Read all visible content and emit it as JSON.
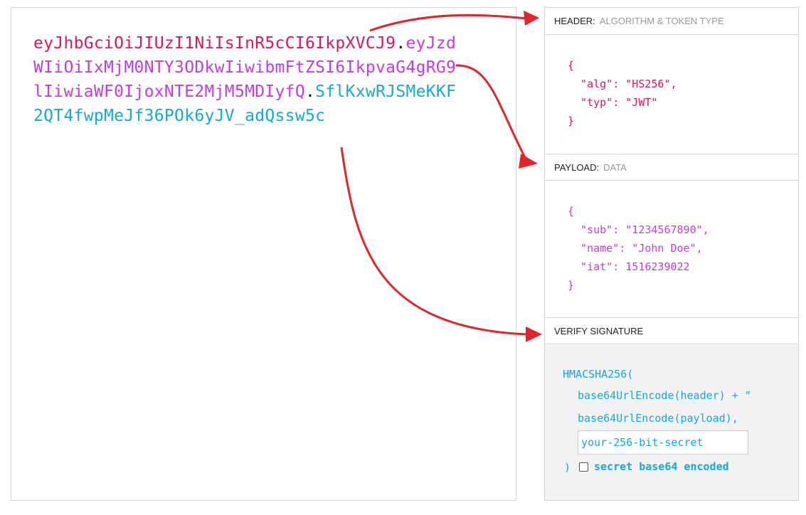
{
  "token": {
    "header_part": "eyJhbGciOiJIUzI1NiIsInR5cCI6IkpXVCJ9",
    "payload_part": "eyJzdWIiOiIxMjM0NTY3ODkwIiwibmFtZSI6IkpvaG4gRG9lIiwiaWF0IjoxNTE2MjM5MDIyfQ",
    "signature_part": "SflKxwRJSMeKKF2QT4fwpMeJf36POk6yJV_adQssw5c",
    "dot": "."
  },
  "header_section": {
    "title": "HEADER:",
    "subtitle": "ALGORITHM & TOKEN TYPE",
    "lines": [
      "{",
      "  \"alg\": \"HS256\",",
      "  \"typ\": \"JWT\"",
      "}"
    ]
  },
  "payload_section": {
    "title": "PAYLOAD:",
    "subtitle": "DATA",
    "lines": [
      "{",
      "  \"sub\": \"1234567890\",",
      "  \"name\": \"John Doe\",",
      "  \"iat\": 1516239022",
      "}"
    ]
  },
  "signature_section": {
    "title": "VERIFY SIGNATURE",
    "line1": "HMACSHA256(",
    "line2": "base64UrlEncode(header) + \"",
    "line3": "base64UrlEncode(payload),",
    "secret_placeholder": "your-256-bit-secret",
    "close_paren": ")",
    "checkbox_label": "secret base64 encoded"
  },
  "colors": {
    "header": "#e0155f",
    "payload": "#c43be6",
    "signature": "#11a9e0",
    "arrow": "#e3242b"
  }
}
